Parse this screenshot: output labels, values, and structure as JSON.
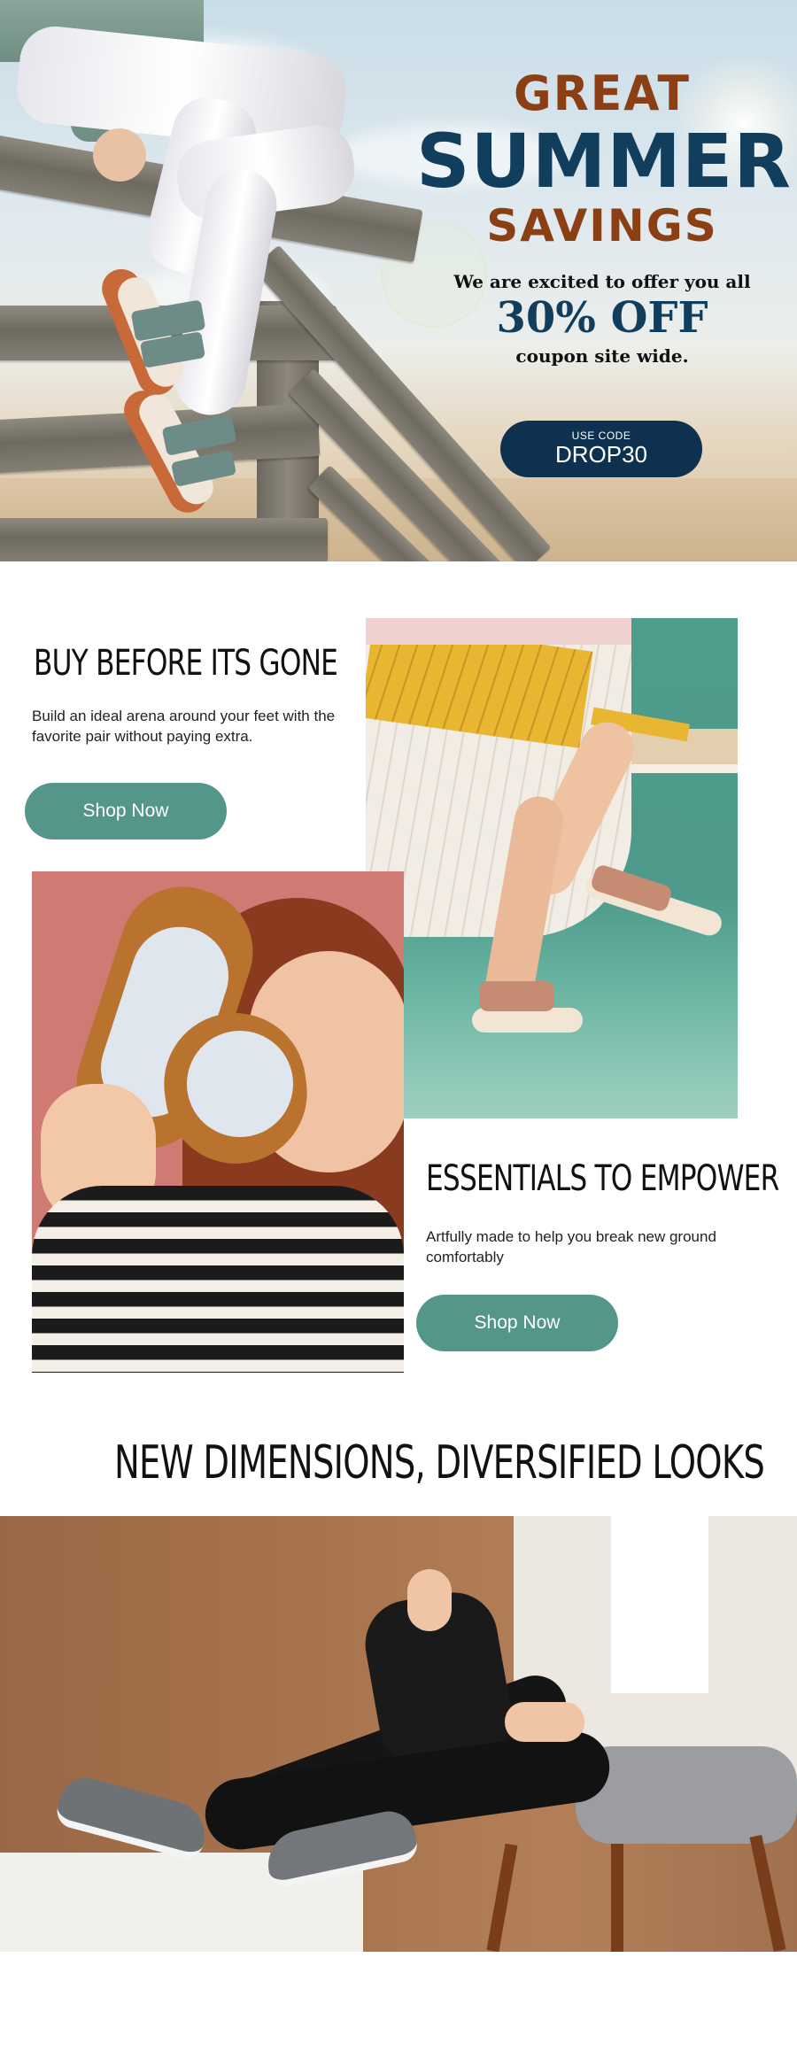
{
  "hero": {
    "headline_top": "GREAT",
    "headline_main": "SUMMER",
    "headline_bottom": "SAVINGS",
    "offer_intro": "We are excited to offer you all",
    "offer_amount": "30% OFF",
    "offer_outro": "coupon site wide.",
    "coupon": {
      "label": "USE CODE",
      "code": "DROP30"
    },
    "colors": {
      "brown": "#8b3f14",
      "navy": "#123e5e",
      "pill": "#0f3150"
    }
  },
  "section_buy": {
    "title": "BUY BEFORE ITS GONE",
    "description": "Build an ideal arena around your feet with the favorite pair without paying extra.",
    "button_label": "Shop Now"
  },
  "section_essentials": {
    "title": "ESSENTIALS TO EMPOWER",
    "description": "Artfully made to help you break new ground comfortably",
    "button_label": "Shop Now"
  },
  "section_dimensions": {
    "title": "NEW DIMENSIONS, DIVERSIFIED LOOKS"
  },
  "theme": {
    "button_color": "#55968a"
  }
}
